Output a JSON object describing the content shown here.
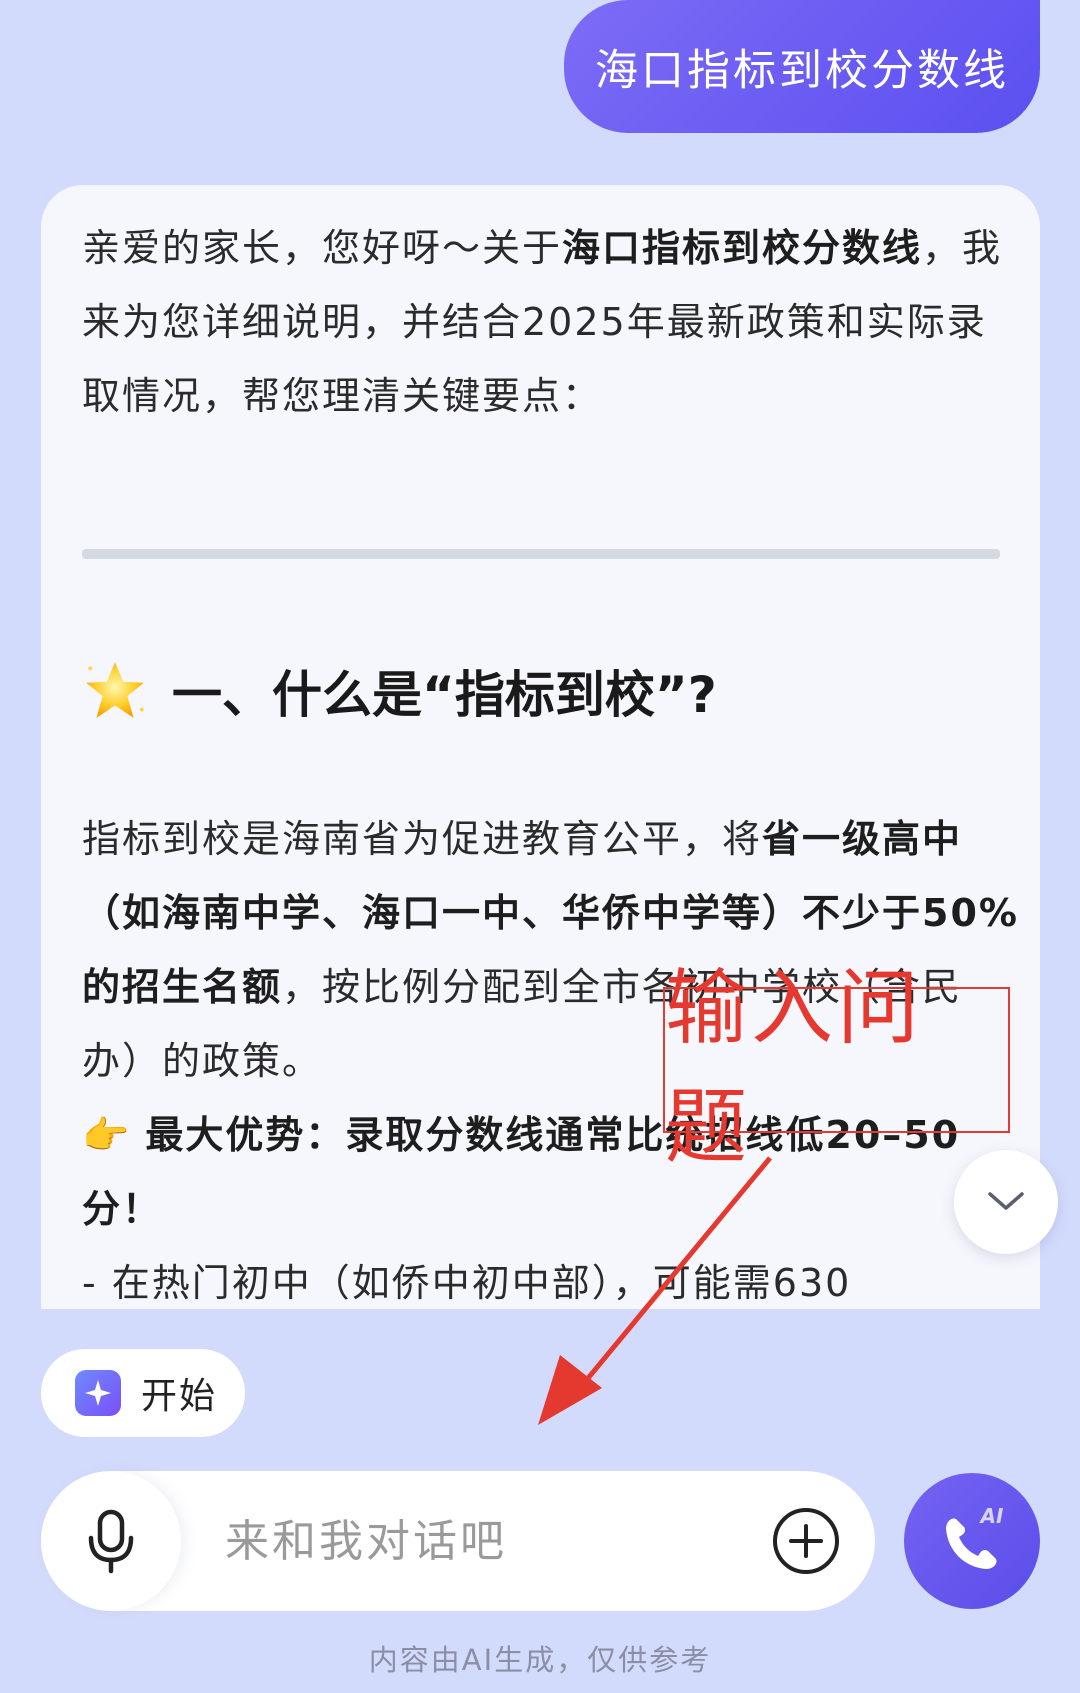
{
  "user_query": "海口指标到校分数线",
  "answer": {
    "intro": [
      {
        "t": "亲爱的家长，您好呀～关于",
        "b": false
      },
      {
        "t": "海口指标到校分数线",
        "b": true
      },
      {
        "t": "，我来为您详细说明，并结合2025年最新政策和实际录取情况，帮您理清关键要点：",
        "b": false
      }
    ],
    "section_title": "一、什么是“指标到校”?",
    "section_para": [
      {
        "t": "指标到校是海南省为促进教育公平，将",
        "b": false
      },
      {
        "t": "省一级高中（如海南中学、海口一中、华侨中学等）不少于50%的招生名额",
        "b": true
      },
      {
        "t": "，按比例分配到全市各初中学校（含民办）的政策。",
        "b": false
      }
    ],
    "advantage_emoji": "👉",
    "advantage": "最大优势：录取分数线通常比统招线低20–50分！",
    "bullet_partial": "- 在热门初中（如侨中初中部），可能需630"
  },
  "annotation": "输入问题",
  "chip_start": "开始",
  "input": {
    "placeholder": "来和我对话吧"
  },
  "call_badge": "AI",
  "disclaimer": "内容由AI生成，仅供参考",
  "colors": {
    "accent": "#5b4ff0",
    "background": "#d3dbfd",
    "annotation": "#e5382f"
  }
}
